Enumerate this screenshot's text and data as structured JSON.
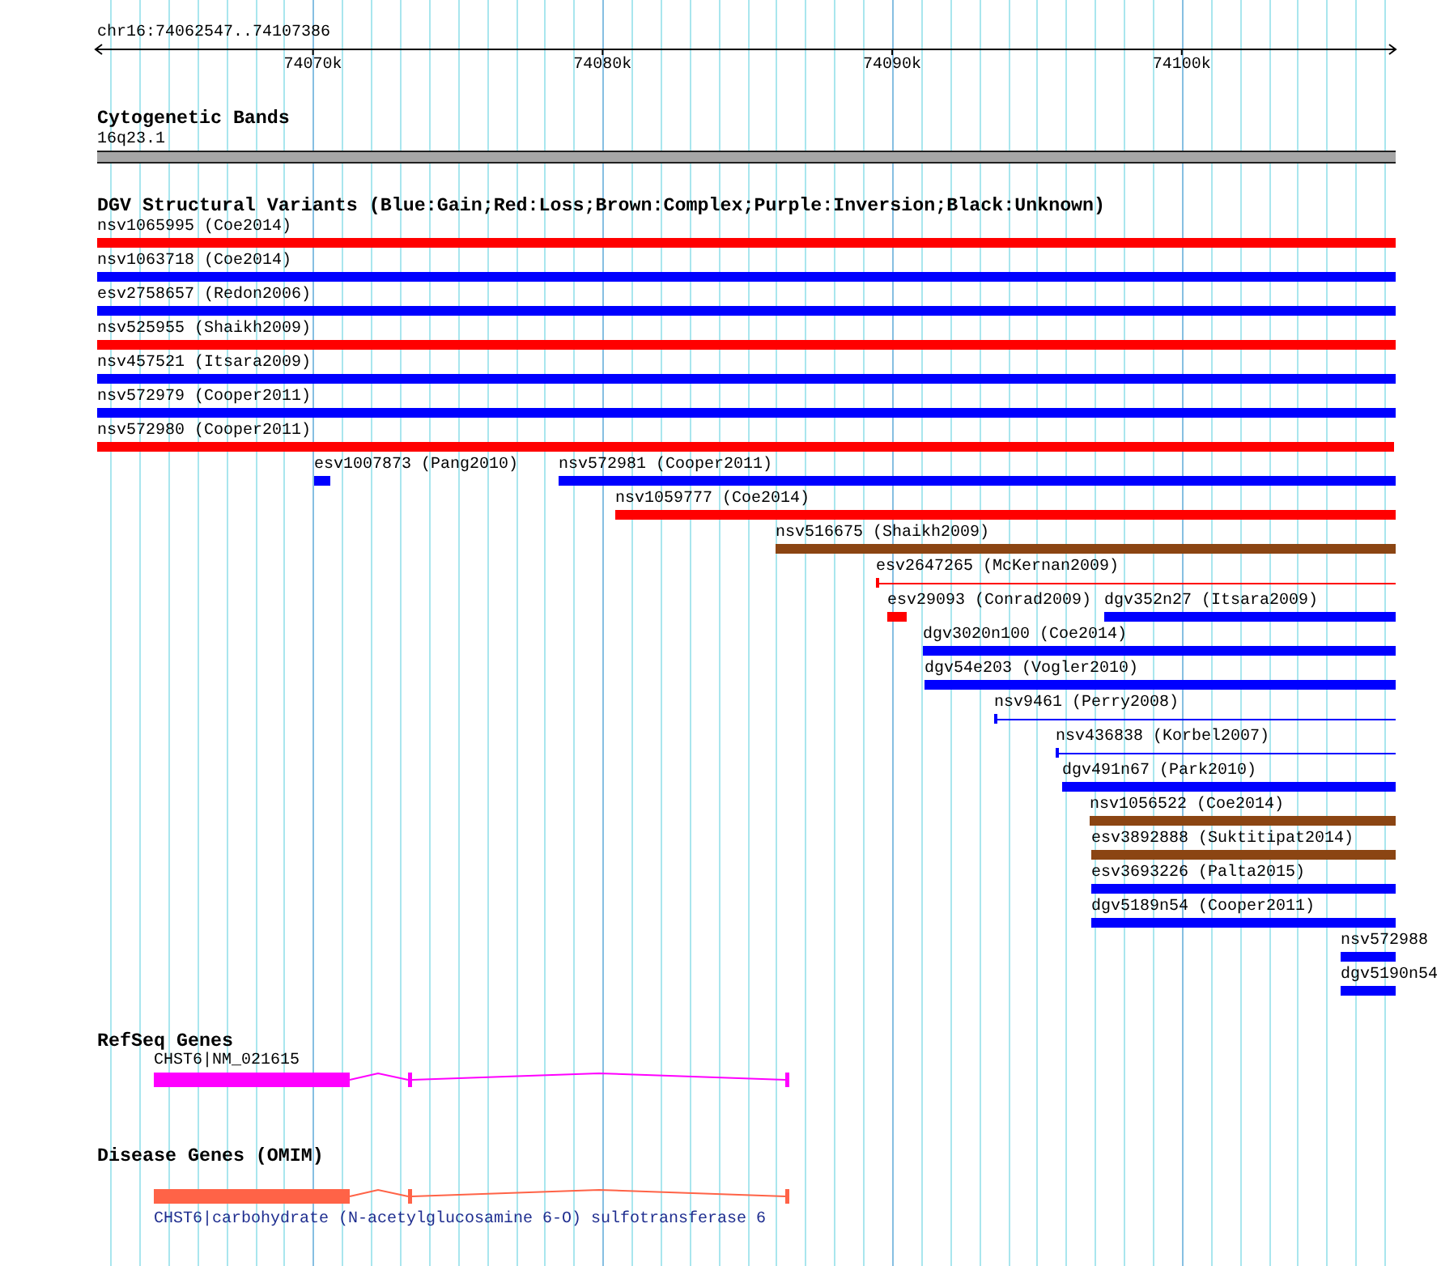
{
  "ruler": {
    "region": "chr16:74062547..74107386",
    "ticks": [
      "74070k",
      "74080k",
      "74090k",
      "74100k"
    ]
  },
  "cytogenetic_bands": {
    "title": "Cytogenetic Bands",
    "bands": [
      {
        "label": "16q23.1"
      }
    ]
  },
  "dgv_variants": {
    "title": "DGV Structural Variants (Blue:Gain;Red:Loss;Brown:Complex;Purple:Inversion;Black:Unknown)",
    "rows": [
      {
        "variants": [
          {
            "label": "nsv1065995 (Coe2014)",
            "kind": "bar",
            "color": "#ff0000"
          }
        ]
      },
      {
        "variants": [
          {
            "label": "nsv1063718 (Coe2014)",
            "kind": "bar",
            "color": "#0000ff"
          }
        ]
      },
      {
        "variants": [
          {
            "label": "esv2758657 (Redon2006)",
            "kind": "bar",
            "color": "#0000ff"
          }
        ]
      },
      {
        "variants": [
          {
            "label": "nsv525955 (Shaikh2009)",
            "kind": "bar",
            "color": "#ff0000"
          }
        ]
      },
      {
        "variants": [
          {
            "label": "nsv457521 (Itsara2009)",
            "kind": "bar",
            "color": "#0000ff"
          }
        ]
      },
      {
        "variants": [
          {
            "label": "nsv572979 (Cooper2011)",
            "kind": "bar",
            "color": "#0000ff"
          }
        ]
      },
      {
        "variants": [
          {
            "label": "nsv572980 (Cooper2011)",
            "kind": "bar",
            "color": "#ff0000"
          }
        ]
      },
      {
        "variants": [
          {
            "label": "esv1007873 (Pang2010)",
            "kind": "bar",
            "color": "#0000ff"
          },
          {
            "label": "nsv572981 (Cooper2011)",
            "kind": "bar",
            "color": "#0000ff"
          }
        ]
      },
      {
        "variants": [
          {
            "label": "nsv1059777 (Coe2014)",
            "kind": "bar",
            "color": "#ff0000"
          }
        ]
      },
      {
        "variants": [
          {
            "label": "nsv516675 (Shaikh2009)",
            "kind": "bar",
            "color": "#8b4513"
          }
        ]
      },
      {
        "variants": [
          {
            "label": "esv2647265 (McKernan2009)",
            "kind": "line",
            "color": "#ff0000"
          }
        ]
      },
      {
        "variants": [
          {
            "label": "esv29093 (Conrad2009)",
            "kind": "bar",
            "color": "#ff0000"
          },
          {
            "label": "dgv352n27 (Itsara2009)",
            "kind": "bar",
            "color": "#0000ff"
          }
        ]
      },
      {
        "variants": [
          {
            "label": "dgv3020n100 (Coe2014)",
            "kind": "bar",
            "color": "#0000ff"
          }
        ]
      },
      {
        "variants": [
          {
            "label": "dgv54e203 (Vogler2010)",
            "kind": "bar",
            "color": "#0000ff"
          }
        ]
      },
      {
        "variants": [
          {
            "label": "nsv9461 (Perry2008)",
            "kind": "line",
            "color": "#0000ff"
          }
        ]
      },
      {
        "variants": [
          {
            "label": "nsv436838 (Korbel2007)",
            "kind": "line",
            "color": "#0000ff"
          }
        ]
      },
      {
        "variants": [
          {
            "label": "dgv491n67 (Park2010)",
            "kind": "bar",
            "color": "#0000ff"
          }
        ]
      },
      {
        "variants": [
          {
            "label": "nsv1056522 (Coe2014)",
            "kind": "bar",
            "color": "#8b4513"
          }
        ]
      },
      {
        "variants": [
          {
            "label": "esv3892888 (Suktitipat2014)",
            "kind": "bar",
            "color": "#8b4513"
          }
        ]
      },
      {
        "variants": [
          {
            "label": "esv3693226 (Palta2015)",
            "kind": "bar",
            "color": "#0000ff"
          }
        ]
      },
      {
        "variants": [
          {
            "label": "dgv5189n54 (Cooper2011)",
            "kind": "bar",
            "color": "#0000ff"
          }
        ]
      },
      {
        "variants": [
          {
            "label": "nsv572988",
            "kind": "bar",
            "color": "#0000ff"
          }
        ]
      },
      {
        "variants": [
          {
            "label": "dgv5190n54",
            "kind": "bar",
            "color": "#0000ff"
          }
        ]
      }
    ]
  },
  "refseq_genes": {
    "title": "RefSeq Genes",
    "genes": [
      {
        "label": "CHST6|NM_021615"
      }
    ]
  },
  "disease_genes": {
    "title": "Disease Genes (OMIM)",
    "genes": [
      {
        "label": "CHST6|carbohydrate (N-acetylglucosamine 6-O) sulfotransferase 6"
      }
    ]
  }
}
